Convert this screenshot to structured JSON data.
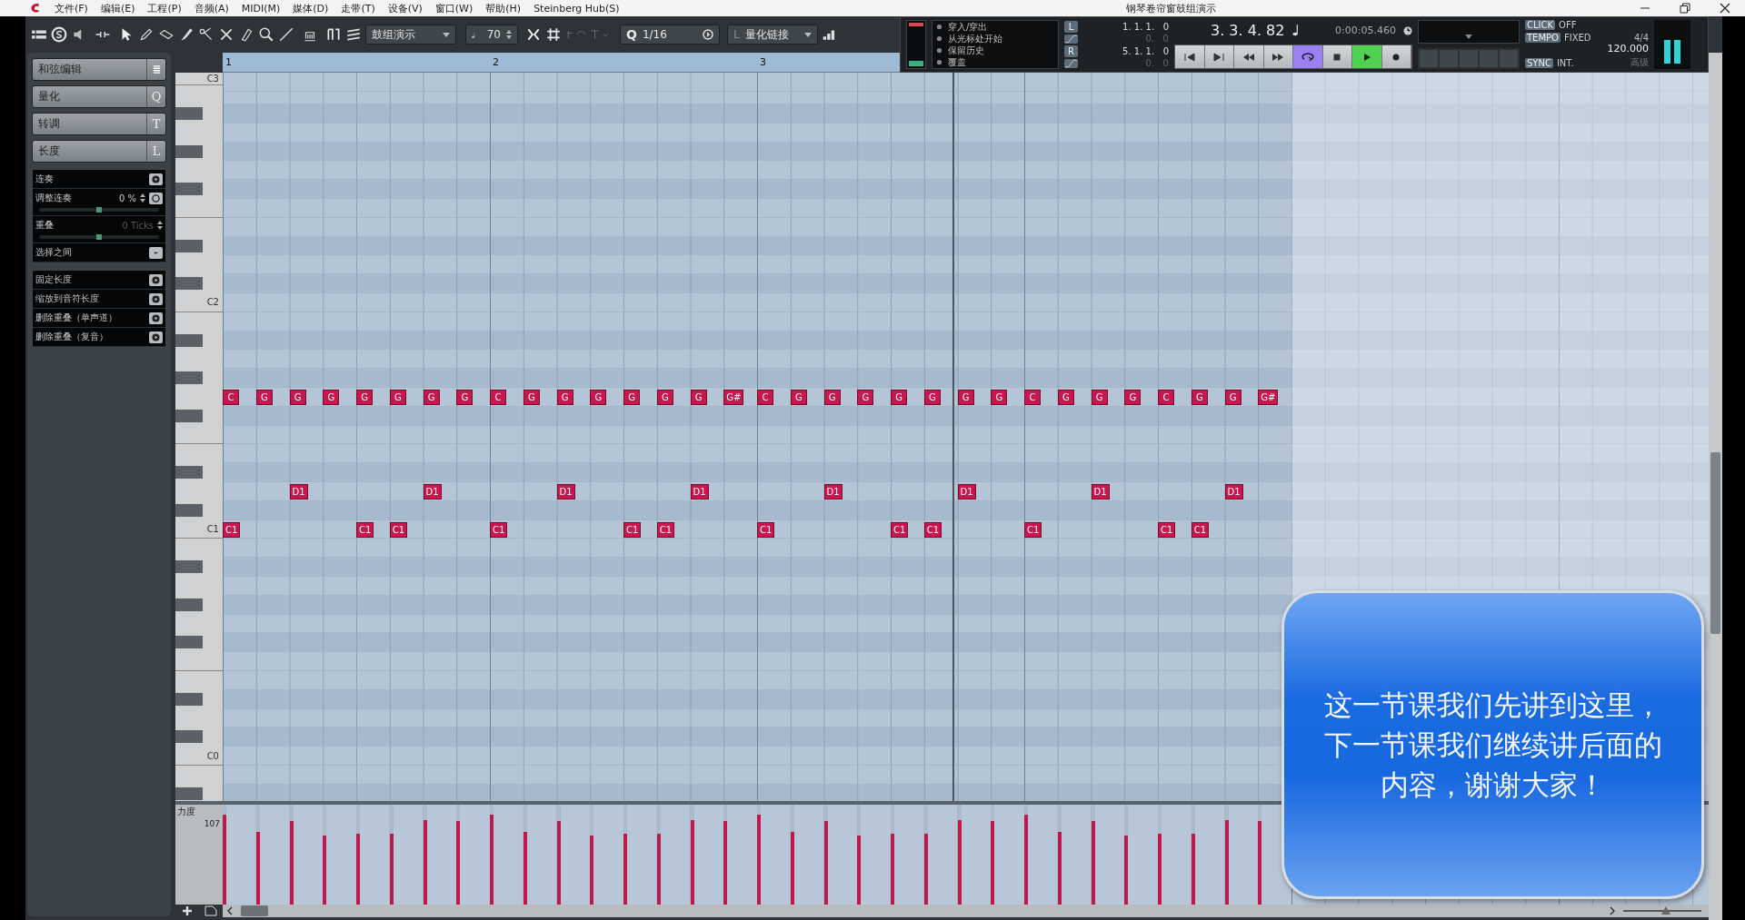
{
  "window": {
    "title": "钢琴卷帘窗鼓组演示"
  },
  "menu": [
    "文件(F)",
    "编辑(E)",
    "工程(P)",
    "音频(A)",
    "MIDI(M)",
    "媒体(D)",
    "走带(T)",
    "设备(V)",
    "窗口(W)",
    "帮助(H)",
    "Steinberg Hub(S)"
  ],
  "toolbar": {
    "track_name": "鼓组演示",
    "velocity": "70",
    "quantize_letter": "Q",
    "quantize": "1/16",
    "link_letter": "L",
    "quantize_link": "量化链接"
  },
  "inspector": {
    "sections": [
      {
        "kind": "icon",
        "label": "和弦编辑"
      },
      {
        "kind": "letter",
        "label": "量化",
        "key": "Q"
      },
      {
        "kind": "letter",
        "label": "转调",
        "key": "T"
      },
      {
        "kind": "letter",
        "label": "长度",
        "key": "L"
      }
    ],
    "tools": [
      {
        "kind": "action",
        "label": "连奏"
      },
      {
        "kind": "value-action",
        "label": "调整连奏",
        "value": "0 %",
        "level": 0.5,
        "disabled": false
      },
      {
        "kind": "value",
        "label": "重叠",
        "value": "0 Ticks",
        "level": 0.5,
        "disabled": true
      },
      {
        "kind": "choice",
        "label": "选择之间"
      }
    ],
    "actions": [
      "固定长度",
      "缩放到音符长度",
      "删除重叠（单声道）",
      "删除重叠（复音）"
    ]
  },
  "transport": {
    "modes": [
      "穿入/穿出",
      "从光标处开始",
      "保留历史",
      "覆盖"
    ],
    "left_locator": {
      "letter": "L",
      "position": "1. 1. 1.   0",
      "offset": "0.   0"
    },
    "right_locator": {
      "letter": "R",
      "position": "5. 1. 1.   0",
      "offset": "0.   0"
    },
    "position": "3. 3. 4. 82",
    "time": "0:00:05.460",
    "buttons": [
      {
        "kind": "start",
        "active": false
      },
      {
        "kind": "end",
        "active": false
      },
      {
        "kind": "rewind",
        "active": false
      },
      {
        "kind": "forward",
        "active": false
      },
      {
        "kind": "cycle",
        "active": true
      },
      {
        "kind": "stop",
        "active": false
      },
      {
        "kind": "play",
        "active": true
      },
      {
        "kind": "record",
        "active": false
      }
    ],
    "click": {
      "label": "CLICK",
      "value": "OFF"
    },
    "tempo": {
      "label": "TEMPO",
      "mode": "FIXED",
      "signature": "4/4",
      "bpm": "120.000"
    },
    "sync": {
      "label": "SYNC",
      "value": "INT.",
      "extra": "高级"
    }
  },
  "editor": {
    "bars": [
      "1",
      "2",
      "3"
    ],
    "octave_labels": [
      "C3",
      "C2",
      "C1",
      "C0"
    ],
    "steps": [
      {
        "upper": "C",
        "lower": "C1",
        "level": 0.9
      },
      {
        "upper": "G",
        "level": 0.73
      },
      {
        "upper": "G",
        "middle": "D1",
        "level": 0.84
      },
      {
        "upper": "G",
        "level": 0.69
      },
      {
        "upper": "G",
        "lower": "C1",
        "level": 0.71
      },
      {
        "upper": "G",
        "lower": "C1",
        "level": 0.71
      },
      {
        "upper": "G",
        "middle": "D1",
        "level": 0.85
      },
      {
        "upper": "G",
        "level": 0.84
      },
      {
        "upper": "C",
        "lower": "C1",
        "level": 0.9
      },
      {
        "upper": "G",
        "level": 0.73
      },
      {
        "upper": "G",
        "middle": "D1",
        "level": 0.84
      },
      {
        "upper": "G",
        "level": 0.69
      },
      {
        "upper": "G",
        "lower": "C1",
        "level": 0.71
      },
      {
        "upper": "G",
        "lower": "C1",
        "level": 0.71
      },
      {
        "upper": "G",
        "middle": "D1",
        "level": 0.85
      },
      {
        "upper": "G#",
        "level": 0.84
      },
      {
        "upper": "C",
        "lower": "C1",
        "level": 0.9
      },
      {
        "upper": "G",
        "level": 0.73
      },
      {
        "upper": "G",
        "middle": "D1",
        "level": 0.84
      },
      {
        "upper": "G",
        "level": 0.69
      },
      {
        "upper": "G",
        "lower": "C1",
        "level": 0.71
      },
      {
        "upper": "G",
        "lower": "C1",
        "level": 0.71
      },
      {
        "upper": "G",
        "middle": "D1",
        "level": 0.85
      },
      {
        "upper": "G",
        "level": 0.84
      },
      {
        "upper": "C",
        "lower": "C1",
        "level": 0.9
      },
      {
        "upper": "G",
        "level": 0.73
      },
      {
        "upper": "G",
        "middle": "D1",
        "level": 0.84
      },
      {
        "upper": "G",
        "level": 0.69
      },
      {
        "upper": "C",
        "lower": "C1",
        "level": 0.71
      },
      {
        "upper": "G",
        "lower": "C1",
        "level": 0.71
      },
      {
        "upper": "G",
        "middle": "D1",
        "level": 0.85
      },
      {
        "upper": "G#",
        "level": 0.84
      }
    ],
    "velocity": {
      "label": "力度",
      "max": "107"
    },
    "zoom_slider": {
      "level": 0.55
    }
  },
  "caption": {
    "lines": [
      "这一节课我们先讲到这里，",
      "下一节课我们继续讲后面的",
      "内容，谢谢大家！"
    ]
  }
}
